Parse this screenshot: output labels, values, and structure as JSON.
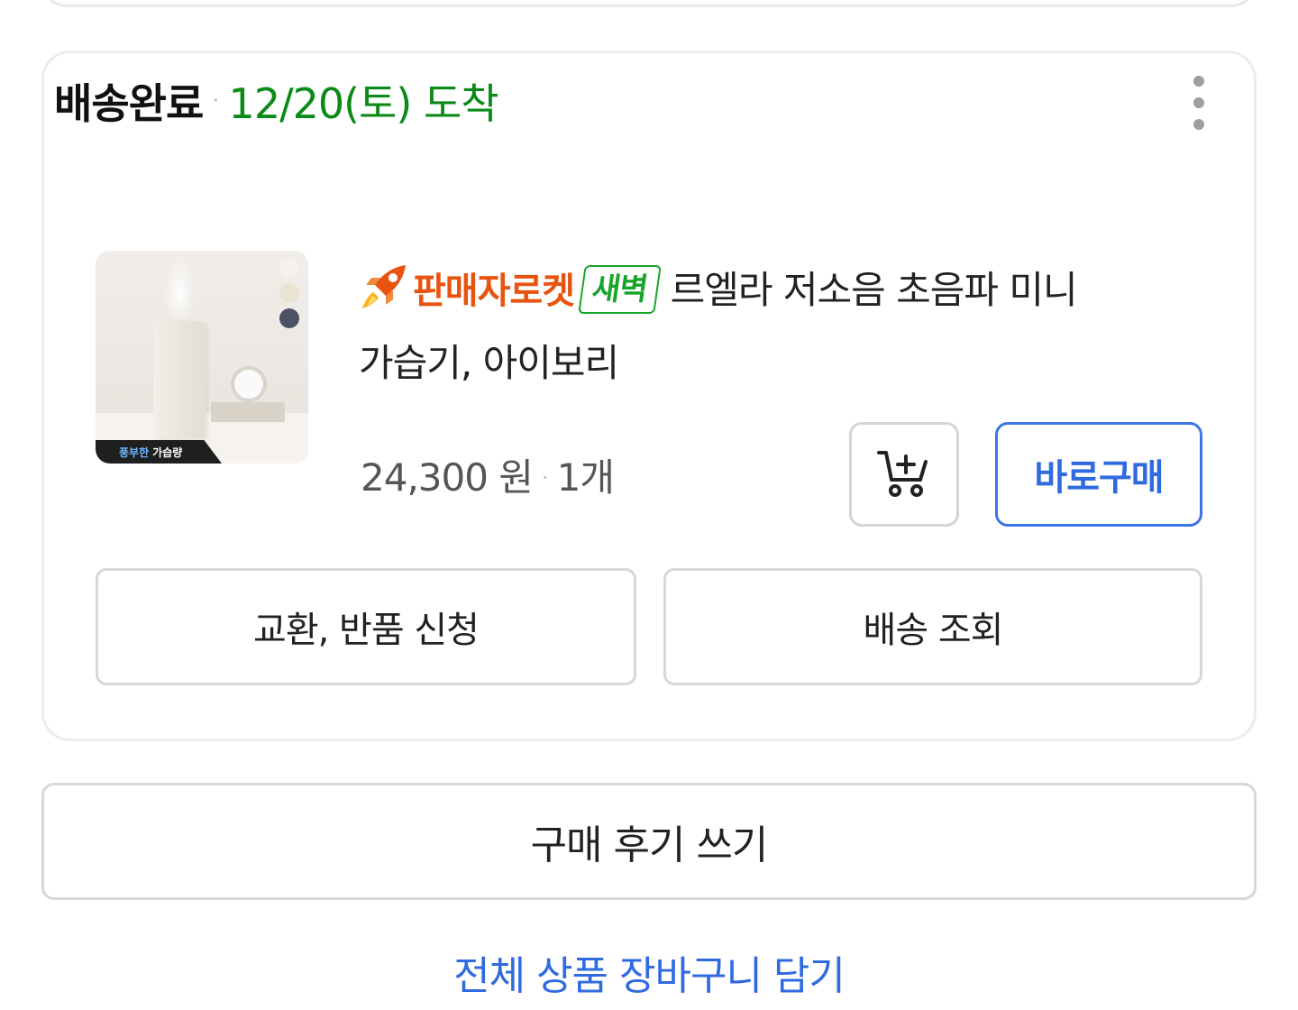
{
  "order": {
    "status": "배송완료",
    "separator": "·",
    "arrival": "12/20(토) 도착",
    "menu_icon": "more-vertical-icon"
  },
  "product": {
    "image_banner_highlight": "풍부한",
    "image_banner_text": "가습량",
    "delivery_icon": "rocket-icon",
    "delivery_brand": "판매자로켓",
    "dawn_badge": "새벽",
    "name_line1": "르엘라 저소음 초음파 미니",
    "name_line2": "가습기, 아이보리",
    "price": "24,300 원",
    "separator": "·",
    "quantity": "1개",
    "swatches": [
      "#f4f2ee",
      "#ebe3d2",
      "#4c5263"
    ]
  },
  "buttons": {
    "add_to_cart_icon": "cart-plus-icon",
    "buy_now": "바로구매",
    "exchange_return": "교환, 반품 신청",
    "track_delivery": "배송 조회",
    "write_review": "구매 후기 쓰기",
    "add_all_to_cart": "전체 상품 장바구니 담기"
  },
  "colors": {
    "arrival_green": "#0b8a17",
    "rocket_orange": "#e8540f",
    "dawn_green": "#17a42a",
    "accent_blue": "#2f6bdf"
  }
}
